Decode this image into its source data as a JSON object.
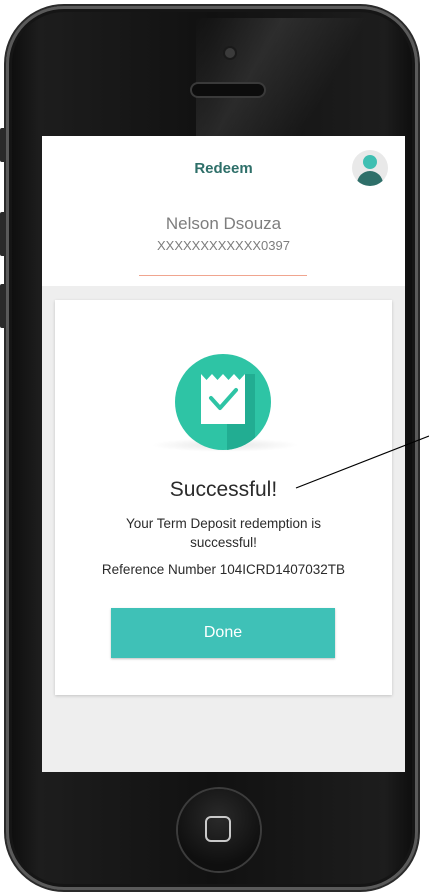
{
  "screen": {
    "title": "Redeem",
    "account": {
      "name": "Nelson Dsouza",
      "number": "XXXXXXXXXXXX0397"
    },
    "result": {
      "title": "Successful!",
      "message": "Your Term Deposit redemption is successful!",
      "reference": "Reference Number 104ICRD1407032TB",
      "done_label": "Done"
    }
  },
  "icons": {
    "avatar": "user-avatar-icon",
    "receipt": "receipt-check-icon",
    "home": "home-button-icon"
  },
  "colors": {
    "accent": "#3fc1b7",
    "title_teal": "#2e6f69",
    "receipt_green": "#2ec4a5",
    "divider": "#f0a58f",
    "screen_bg": "#eeeeee"
  }
}
